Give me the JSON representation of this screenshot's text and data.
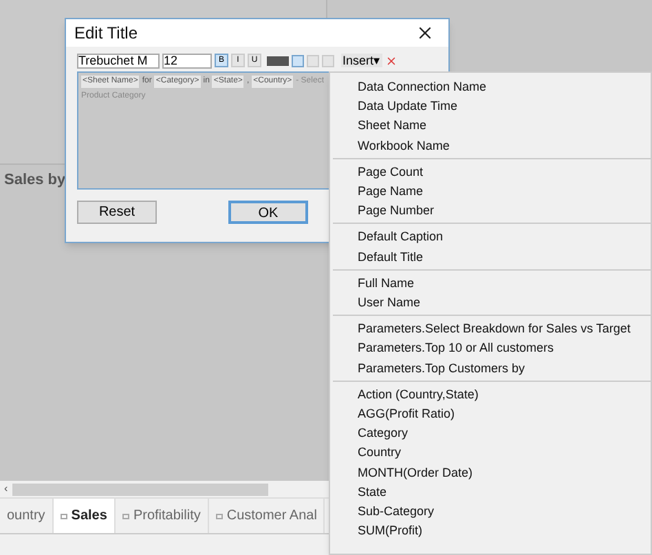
{
  "worksheet": {
    "title": "Sales by"
  },
  "scroll_left": "‹",
  "dialog": {
    "title": "Edit Title",
    "font": "Trebuchet M",
    "size": "12",
    "format_buttons": [
      {
        "label": "B",
        "selected": true
      },
      {
        "label": "I",
        "selected": false
      },
      {
        "label": "U",
        "selected": false
      }
    ],
    "align_buttons": [
      {
        "selected": true
      },
      {
        "selected": false
      },
      {
        "selected": false
      }
    ],
    "insert": "Insert",
    "insert_caret": "▾",
    "content": [
      {
        "kind": "field",
        "text": "<Sheet Name>"
      },
      {
        "kind": "text",
        "text": "for"
      },
      {
        "kind": "field",
        "text": "<Category>"
      },
      {
        "kind": "text",
        "text": "in"
      },
      {
        "kind": "field",
        "text": "<State>"
      },
      {
        "kind": "text",
        "text": ","
      },
      {
        "kind": "field",
        "text": "<Country>"
      },
      {
        "kind": "hint",
        "text": "- Select"
      }
    ],
    "second_line": "Product Category",
    "buttons": [
      {
        "label": "Reset",
        "focused": false
      },
      {
        "label": "OK",
        "focused": true
      }
    ]
  },
  "menu": [
    [
      "Data Connection Name",
      "Data Update Time",
      "Sheet Name",
      "Workbook Name"
    ],
    [
      "Page Count",
      "Page Name",
      "Page Number"
    ],
    [
      "Default Caption",
      "Default Title"
    ],
    [
      "Full Name",
      "User Name"
    ],
    [
      "Parameters.Select Breakdown for Sales vs Target",
      "Parameters.Top 10 or All customers",
      "Parameters.Top Customers by"
    ],
    [
      "Action (Country,State)",
      "AGG(Profit Ratio)",
      "Category",
      "Country",
      "MONTH(Order Date)",
      "State",
      "Sub-Category",
      "SUM(Profit)"
    ]
  ],
  "tabs": [
    {
      "label": "ountry",
      "selected": false
    },
    {
      "label": "Sales",
      "selected": true
    },
    {
      "label": "Profitability",
      "selected": false
    },
    {
      "label": "Customer Anal",
      "selected": false
    }
  ]
}
